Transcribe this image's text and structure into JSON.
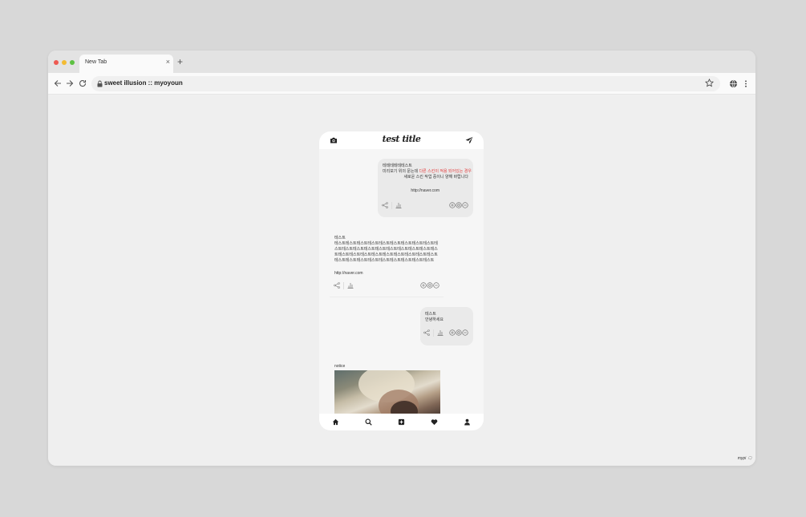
{
  "browser": {
    "tab_title": "New Tab",
    "tab_close": "×",
    "new_tab": "+",
    "url": "sweet illusion :: myoyoun"
  },
  "app": {
    "logo": "test title",
    "posts": [
      {
        "side": "me",
        "lines": [
          "테테테테테테스트"
        ],
        "line2_plain": "미리보기 위의 문는데 ",
        "line2_red": "다른 스킨이 적용 되어있는 경우",
        "line3": "새로운 스킨 작업 중이니 양해 바랍니다",
        "link": "http://naver.com"
      },
      {
        "side": "other",
        "title": "테스트",
        "body_lines": [
          "테스트테스트테스트테스트테스트테스트테스트테스트테스트테",
          "스트테스트테스트테스트테스트테스트테스트테스트테스트테스",
          "트테스트테스트테스트테스트테스트테스트테스트테스트테스트",
          "테스트테스트테스트테스트테스트테스트테스트테스트테스트"
        ],
        "link": "http://naver.com"
      },
      {
        "side": "me",
        "title": "테스트",
        "body": "안녕하세요"
      }
    ],
    "notice_label": "notice"
  },
  "footer": {
    "badge": "mypi 🗨"
  },
  "colors": {
    "accent_red": "#e23a3a",
    "bubble_me": "#eaeaea",
    "window_bg": "#efefef"
  },
  "icons": {
    "header_left": "camera-icon",
    "header_right": "paper-plane-icon",
    "bottom": [
      "home-icon",
      "search-icon",
      "plus-square-icon",
      "heart-icon",
      "user-icon"
    ]
  }
}
